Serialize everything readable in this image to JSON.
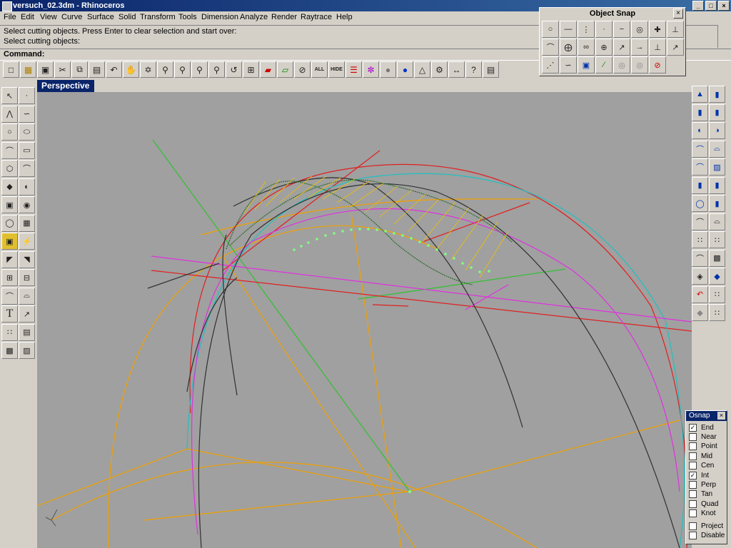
{
  "window": {
    "title": "versuch_02.3dm - Rhinoceros",
    "min": "_",
    "max": "□",
    "close": "×"
  },
  "menu": [
    "File",
    "Edit",
    "View",
    "Curve",
    "Surface",
    "Solid",
    "Transform",
    "Tools",
    "Dimension",
    "Analyze",
    "Render",
    "Raytrace",
    "Help"
  ],
  "command_history": [
    "Select cutting objects. Press Enter to clear selection and start over:",
    "Select cutting objects:"
  ],
  "command_prompt": "Command:",
  "toolbar_text": {
    "all": "ALL",
    "hide": "HIDE"
  },
  "viewport": {
    "label": "Perspective"
  },
  "object_snap": {
    "title": "Object Snap",
    "close": "×"
  },
  "osnap_panel": {
    "title": "Osnap",
    "close": "×",
    "options": [
      {
        "label": "End",
        "checked": true
      },
      {
        "label": "Near",
        "checked": false
      },
      {
        "label": "Point",
        "checked": false
      },
      {
        "label": "Mid",
        "checked": false
      },
      {
        "label": "Cen",
        "checked": false
      },
      {
        "label": "Int",
        "checked": true
      },
      {
        "label": "Perp",
        "checked": false
      },
      {
        "label": "Tan",
        "checked": false
      },
      {
        "label": "Quad",
        "checked": false
      },
      {
        "label": "Knot",
        "checked": false
      }
    ],
    "extras": [
      {
        "label": "Project",
        "checked": false
      },
      {
        "label": "Disable",
        "checked": false
      }
    ]
  },
  "colors": {
    "viewport_bg": "#a0a0a0",
    "active_tab": "#0a246a",
    "panel": "#d4d0c8"
  }
}
